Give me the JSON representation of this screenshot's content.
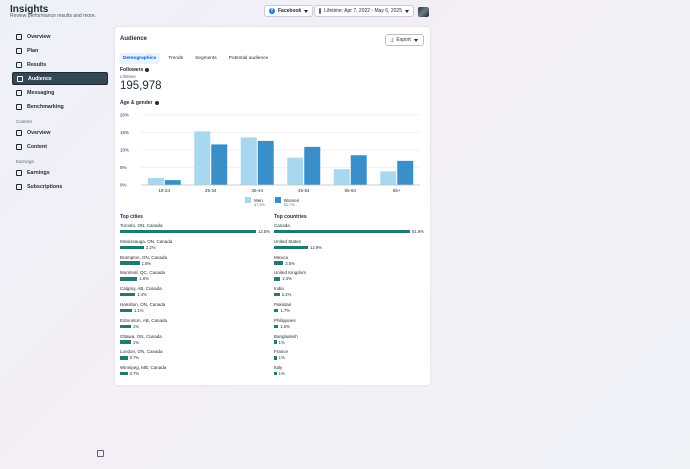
{
  "header": {
    "title": "Insights",
    "subtitle": "Review performance results and more."
  },
  "topbar": {
    "account_label": "Facebook",
    "date_range": "Lifetime: Apr 7, 2022 - May 6, 2025"
  },
  "sidebar": {
    "items": [
      {
        "label": "Overview",
        "icon": "overview-icon",
        "active": false
      },
      {
        "label": "Plan",
        "icon": "plan-icon",
        "active": false
      },
      {
        "label": "Results",
        "icon": "results-icon",
        "active": false
      },
      {
        "label": "Audience",
        "icon": "audience-icon",
        "active": true
      },
      {
        "label": "Messaging",
        "icon": "messaging-icon",
        "active": false
      },
      {
        "label": "Benchmarking",
        "icon": "benchmarking-icon",
        "active": false
      }
    ],
    "content_section": "Content",
    "content_items": [
      {
        "label": "Overview",
        "icon": "content-overview-icon"
      },
      {
        "label": "Content",
        "icon": "content-icon"
      }
    ],
    "earnings_section": "Earnings",
    "earnings_items": [
      {
        "label": "Earnings",
        "icon": "earnings-icon"
      },
      {
        "label": "Subscriptions",
        "icon": "subscriptions-icon"
      }
    ]
  },
  "card": {
    "title": "Audience",
    "export_label": "Export",
    "tabs": [
      "Demographics",
      "Trends",
      "Segments",
      "Potential audience"
    ],
    "followers_label": "Followers",
    "lifetime_label": "Lifetime",
    "followers_count": "195,978",
    "age_gender_label": "Age & gender"
  },
  "colors": {
    "men": "#a8d8f0",
    "women": "#3b8fc9",
    "bar": "#1f7a73",
    "active_nav": "#344854"
  },
  "chart_data": {
    "type": "bar",
    "categories": [
      "18-24",
      "25-34",
      "35-44",
      "45-54",
      "55-64",
      "65+"
    ],
    "series": [
      {
        "name": "Men",
        "values": [
          2,
          15.3,
          13.6,
          7.8,
          4.5,
          3.9
        ]
      },
      {
        "name": "Women",
        "values": [
          1.4,
          11.6,
          12.6,
          10.9,
          8.5,
          6.9
        ]
      }
    ],
    "yticks": [
      "0%",
      "5%",
      "10%",
      "15%",
      "20%"
    ],
    "ylim": [
      0,
      20
    ],
    "grid": true,
    "legend_position": "bottom",
    "legend": [
      {
        "name": "Men",
        "pct": "47.3%"
      },
      {
        "name": "Women",
        "pct": "52.7%"
      }
    ]
  },
  "top_cities": {
    "title": "Top cities",
    "rows": [
      {
        "label": "Toronto, ON, Canada",
        "value": "12.5%",
        "pct": 12.5
      },
      {
        "label": "Mississauga, ON, Canada",
        "value": "2.2%",
        "pct": 2.2
      },
      {
        "label": "Brampton, ON, Canada",
        "value": "1.8%",
        "pct": 1.8
      },
      {
        "label": "Montreal, QC, Canada",
        "value": "1.6%",
        "pct": 1.6
      },
      {
        "label": "Calgary, AB, Canada",
        "value": "1.4%",
        "pct": 1.4
      },
      {
        "label": "Hamilton, ON, Canada",
        "value": "1.1%",
        "pct": 1.1
      },
      {
        "label": "Edmonton, AB, Canada",
        "value": "1%",
        "pct": 1.0
      },
      {
        "label": "Ottawa, ON, Canada",
        "value": "1%",
        "pct": 1.0
      },
      {
        "label": "London, ON, Canada",
        "value": "0.7%",
        "pct": 0.7
      },
      {
        "label": "Winnipeg, MB, Canada",
        "value": "0.7%",
        "pct": 0.7
      }
    ]
  },
  "top_countries": {
    "title": "Top countries",
    "rows": [
      {
        "label": "Canada",
        "value": "51.6%",
        "pct": 51.6
      },
      {
        "label": "United States",
        "value": "12.9%",
        "pct": 12.9
      },
      {
        "label": "Mexico",
        "value": "3.5%",
        "pct": 3.5
      },
      {
        "label": "United Kingdom",
        "value": "2.4%",
        "pct": 2.4
      },
      {
        "label": "India",
        "value": "2.2%",
        "pct": 2.2
      },
      {
        "label": "Pakistan",
        "value": "1.7%",
        "pct": 1.7
      },
      {
        "label": "Philippines",
        "value": "1.6%",
        "pct": 1.6
      },
      {
        "label": "Bangladesh",
        "value": "1%",
        "pct": 1.0
      },
      {
        "label": "France",
        "value": "1%",
        "pct": 1.0
      },
      {
        "label": "Italy",
        "value": "1%",
        "pct": 1.0
      }
    ]
  }
}
